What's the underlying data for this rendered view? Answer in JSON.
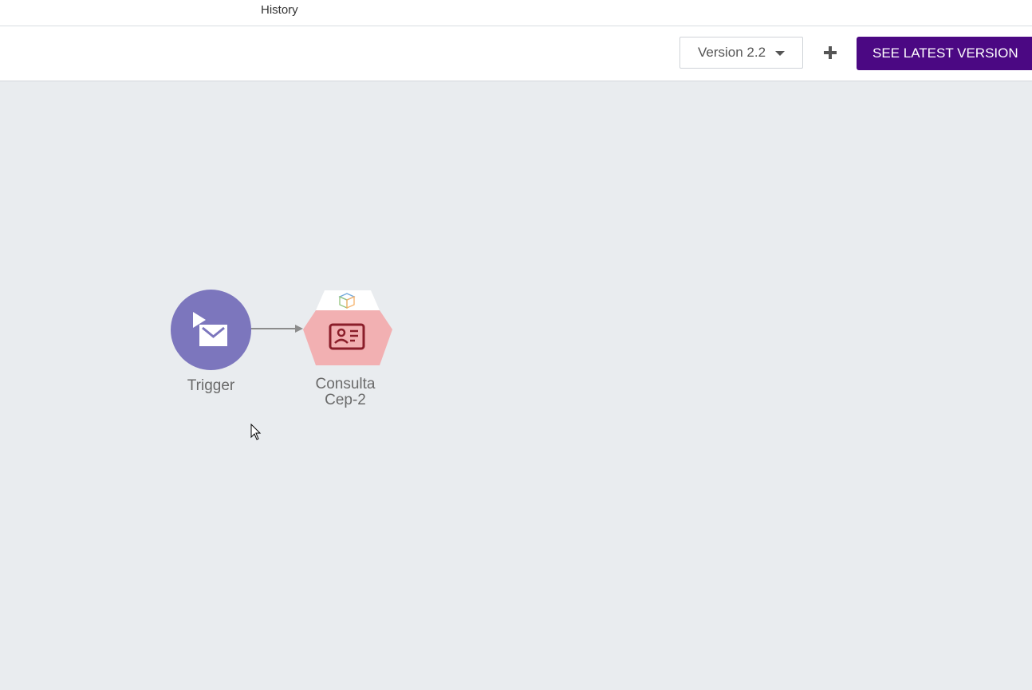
{
  "topbar": {
    "history_tab": "History"
  },
  "toolbar": {
    "version_select": {
      "selected": "Version 2.2"
    },
    "add_icon": "plus-icon",
    "latest_button_label": "SEE LATEST VERSION",
    "accent_color": "#4b0883"
  },
  "canvas": {
    "nodes": [
      {
        "label": "Trigger",
        "icon": "email-trigger-icon",
        "color": "#7c76bd"
      },
      {
        "label_line1": "Consulta",
        "label_line2": "Cep-2",
        "icon": "id-card-icon",
        "badge_icon": "cube-icon",
        "color": "#f2b0b2"
      }
    ]
  }
}
